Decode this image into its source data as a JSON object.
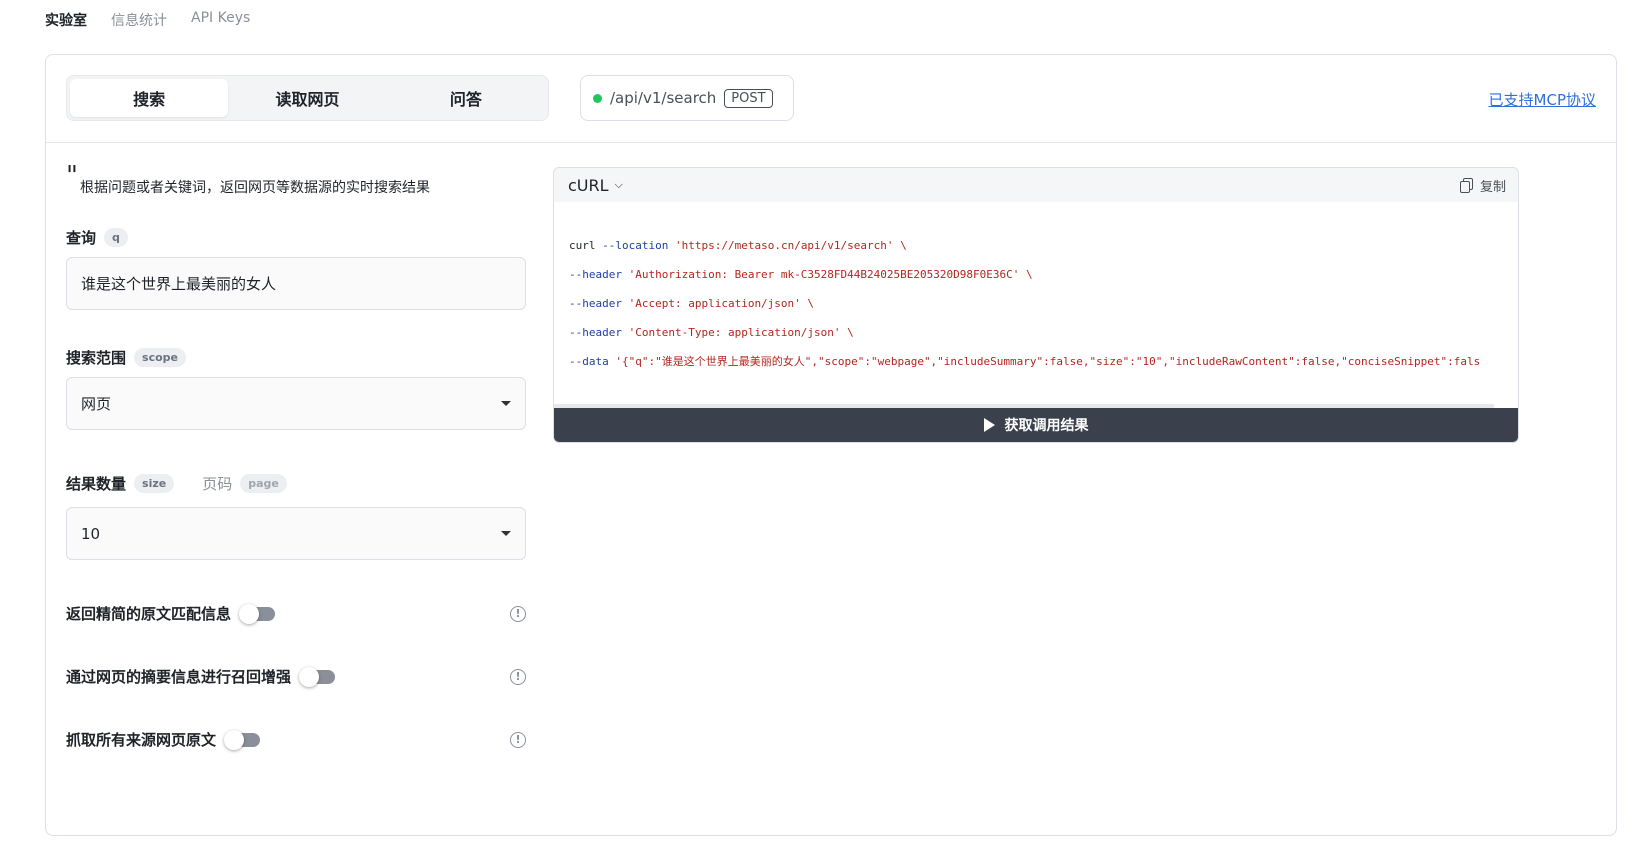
{
  "top_nav": {
    "items": [
      {
        "label": "实验室"
      },
      {
        "label": "信息统计"
      },
      {
        "label": "API Keys"
      }
    ]
  },
  "tabs": [
    {
      "label": "搜索"
    },
    {
      "label": "读取网页"
    },
    {
      "label": "问答"
    }
  ],
  "endpoint": {
    "path": "/api/v1/search",
    "method": "POST",
    "status_color": "#22c55e"
  },
  "mcp_link": "已支持MCP协议",
  "description": "根据问题或者关键词，返回网页等数据源的实时搜索结果",
  "fields": {
    "query": {
      "label": "查询",
      "param": "q",
      "value": "谁是这个世界上最美丽的女人"
    },
    "scope": {
      "label": "搜索范围",
      "param": "scope",
      "value": "网页"
    },
    "size": {
      "label": "结果数量",
      "param": "size",
      "value": "10"
    },
    "page": {
      "label": "页码",
      "param": "page"
    }
  },
  "toggles": [
    {
      "label": "返回精简的原文匹配信息",
      "on": false
    },
    {
      "label": "通过网页的摘要信息进行召回增强",
      "on": false
    },
    {
      "label": "抓取所有来源网页原文",
      "on": false
    }
  ],
  "code_panel": {
    "language": "cURL",
    "copy_label": "复制",
    "run_label": "获取调用结果",
    "lines": [
      {
        "cmd": "curl",
        "flag": "--location",
        "arg": "'https://metaso.cn/api/v1/search' \\"
      },
      {
        "cmd": "",
        "flag": "--header",
        "arg": "'Authorization: Bearer mk-C3528FD44B24025BE205320D98F0E36C' \\"
      },
      {
        "cmd": "",
        "flag": "--header",
        "arg": "'Accept: application/json' \\"
      },
      {
        "cmd": "",
        "flag": "--header",
        "arg": "'Content-Type: application/json' \\"
      },
      {
        "cmd": "",
        "flag": "--data",
        "arg": "'{\"q\":\"谁是这个世界上最美丽的女人\",\"scope\":\"webpage\",\"includeSummary\":false,\"size\":\"10\",\"includeRawContent\":false,\"conciseSnippet\":fals"
      }
    ]
  }
}
